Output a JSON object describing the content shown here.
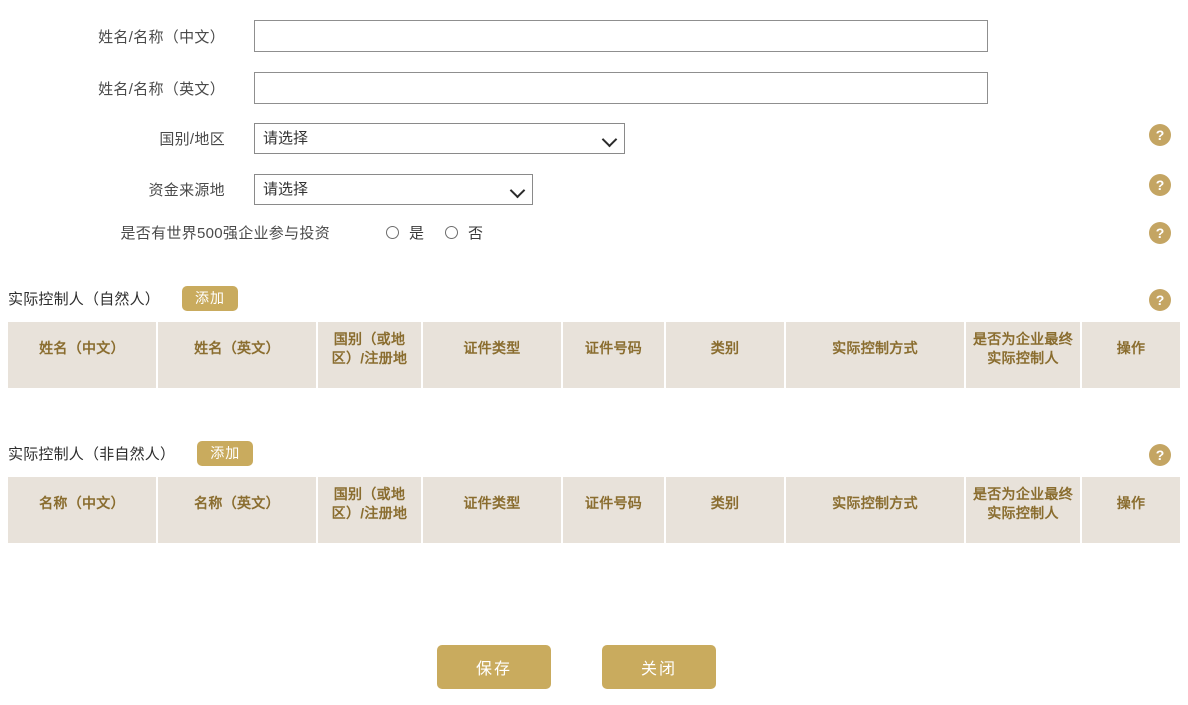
{
  "form": {
    "rows": [
      {
        "label": "姓名/名称（中文）",
        "type": "text",
        "value": "",
        "placeholder": ""
      },
      {
        "label": "姓名/名称（英文）",
        "type": "text",
        "value": "",
        "placeholder": ""
      },
      {
        "label": "国别/地区",
        "type": "select",
        "value": "请选择"
      },
      {
        "label": "资金来源地",
        "type": "select",
        "value": "请选择"
      },
      {
        "label": "是否有世界500强企业参与投资",
        "type": "radio"
      }
    ],
    "radio": {
      "yes_label": "是",
      "no_label": "否",
      "selected": ""
    }
  },
  "help": {
    "glyph": "?",
    "color": "#c4a563"
  },
  "sections": [
    {
      "title": "实际控制人（自然人）",
      "add_label": "添加",
      "columns": [
        "姓名（中文）",
        "姓名（英文）",
        "国别（或地区）/注册地",
        "证件类型",
        "证件号码",
        "类别",
        "实际控制方式",
        "是否为企业最终实际控制人",
        "操作"
      ],
      "rows": []
    },
    {
      "title": "实际控制人（非自然人）",
      "add_label": "添加",
      "columns": [
        "名称（中文）",
        "名称（英文）",
        "国别（或地区）/注册地",
        "证件类型",
        "证件号码",
        "类别",
        "实际控制方式",
        "是否为企业最终实际控制人",
        "操作"
      ],
      "rows": []
    }
  ],
  "footer": {
    "save_label": "保存",
    "close_label": "关闭"
  },
  "theme": {
    "gold": "#c9ab5e",
    "table_header_bg": "#e8e2da",
    "table_header_text": "#8a6d2f"
  }
}
